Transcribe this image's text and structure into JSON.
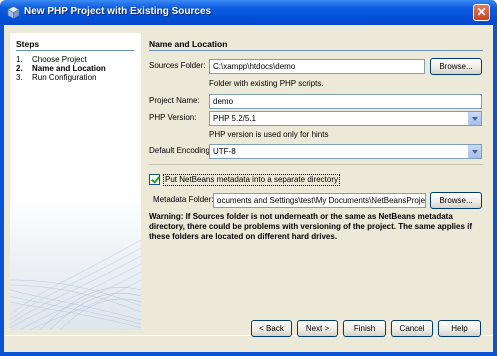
{
  "window": {
    "title": "New PHP Project with Existing Sources",
    "close_glyph": "✕"
  },
  "steps": {
    "heading": "Steps",
    "items": [
      {
        "num": "1.",
        "label": "Choose Project"
      },
      {
        "num": "2.",
        "label": "Name and Location"
      },
      {
        "num": "3.",
        "label": "Run Configuration"
      }
    ]
  },
  "main": {
    "heading": "Name and Location",
    "sources_folder": {
      "label": "Sources Folder:",
      "value": "C:\\xampp\\htdocs\\demo",
      "browse": "Browse...",
      "hint": "Folder with existing PHP scripts."
    },
    "project_name": {
      "label": "Project Name:",
      "value": "demo"
    },
    "php_version": {
      "label": "PHP Version:",
      "value": "PHP 5.2/5.1",
      "hint": "PHP version is used only for hints"
    },
    "encoding": {
      "label": "Default Encoding:",
      "value": "UTF-8"
    },
    "metadata_checkbox": {
      "label": "Put NetBeans metadata into a separate directory",
      "checked": true
    },
    "metadata_folder": {
      "label": "Metadata Folder:",
      "value": "ocuments and Settings\\test\\My Documents\\NetBeansProjects\\demo",
      "browse": "Browse..."
    },
    "warning": "Warning: If Sources folder is not underneath or the same as NetBeans metadata directory, there could be problems with versioning of the project. The same applies if these folders are located on different hard drives."
  },
  "buttons": {
    "back": "< Back",
    "next": "Next >",
    "finish": "Finish",
    "cancel": "Cancel",
    "help": "Help"
  }
}
